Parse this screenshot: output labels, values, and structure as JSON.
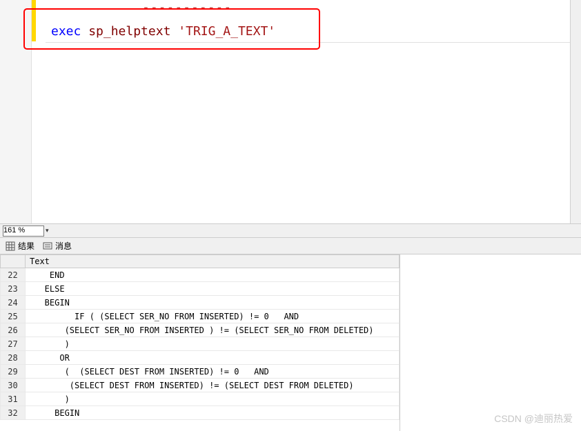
{
  "editor": {
    "dash_marker": "-----------",
    "code": {
      "exec": "exec",
      "proc": "sp_helptext",
      "string": "'TRIG_A_TEXT'"
    }
  },
  "zoom": {
    "value": "161 %"
  },
  "tabs": {
    "results": "结果",
    "messages": "消息"
  },
  "results": {
    "header": "Text",
    "rows": [
      {
        "n": "22",
        "text": "    END  "
      },
      {
        "n": "23",
        "text": "   ELSE  "
      },
      {
        "n": "24",
        "text": "   BEGIN  "
      },
      {
        "n": "25",
        "text": "         IF ( (SELECT SER_NO FROM INSERTED) != 0   AND"
      },
      {
        "n": "26",
        "text": "       (SELECT SER_NO FROM INSERTED ) != (SELECT SER_NO FROM DELETED)  "
      },
      {
        "n": "27",
        "text": "       )  "
      },
      {
        "n": "28",
        "text": "      OR   "
      },
      {
        "n": "29",
        "text": "       (  (SELECT DEST FROM INSERTED) != 0   AND  "
      },
      {
        "n": "30",
        "text": "        (SELECT DEST FROM INSERTED) != (SELECT DEST FROM DELETED)  "
      },
      {
        "n": "31",
        "text": "       )  "
      },
      {
        "n": "32",
        "text": "     BEGIN  "
      }
    ]
  },
  "watermark": "CSDN @迪丽热爱"
}
